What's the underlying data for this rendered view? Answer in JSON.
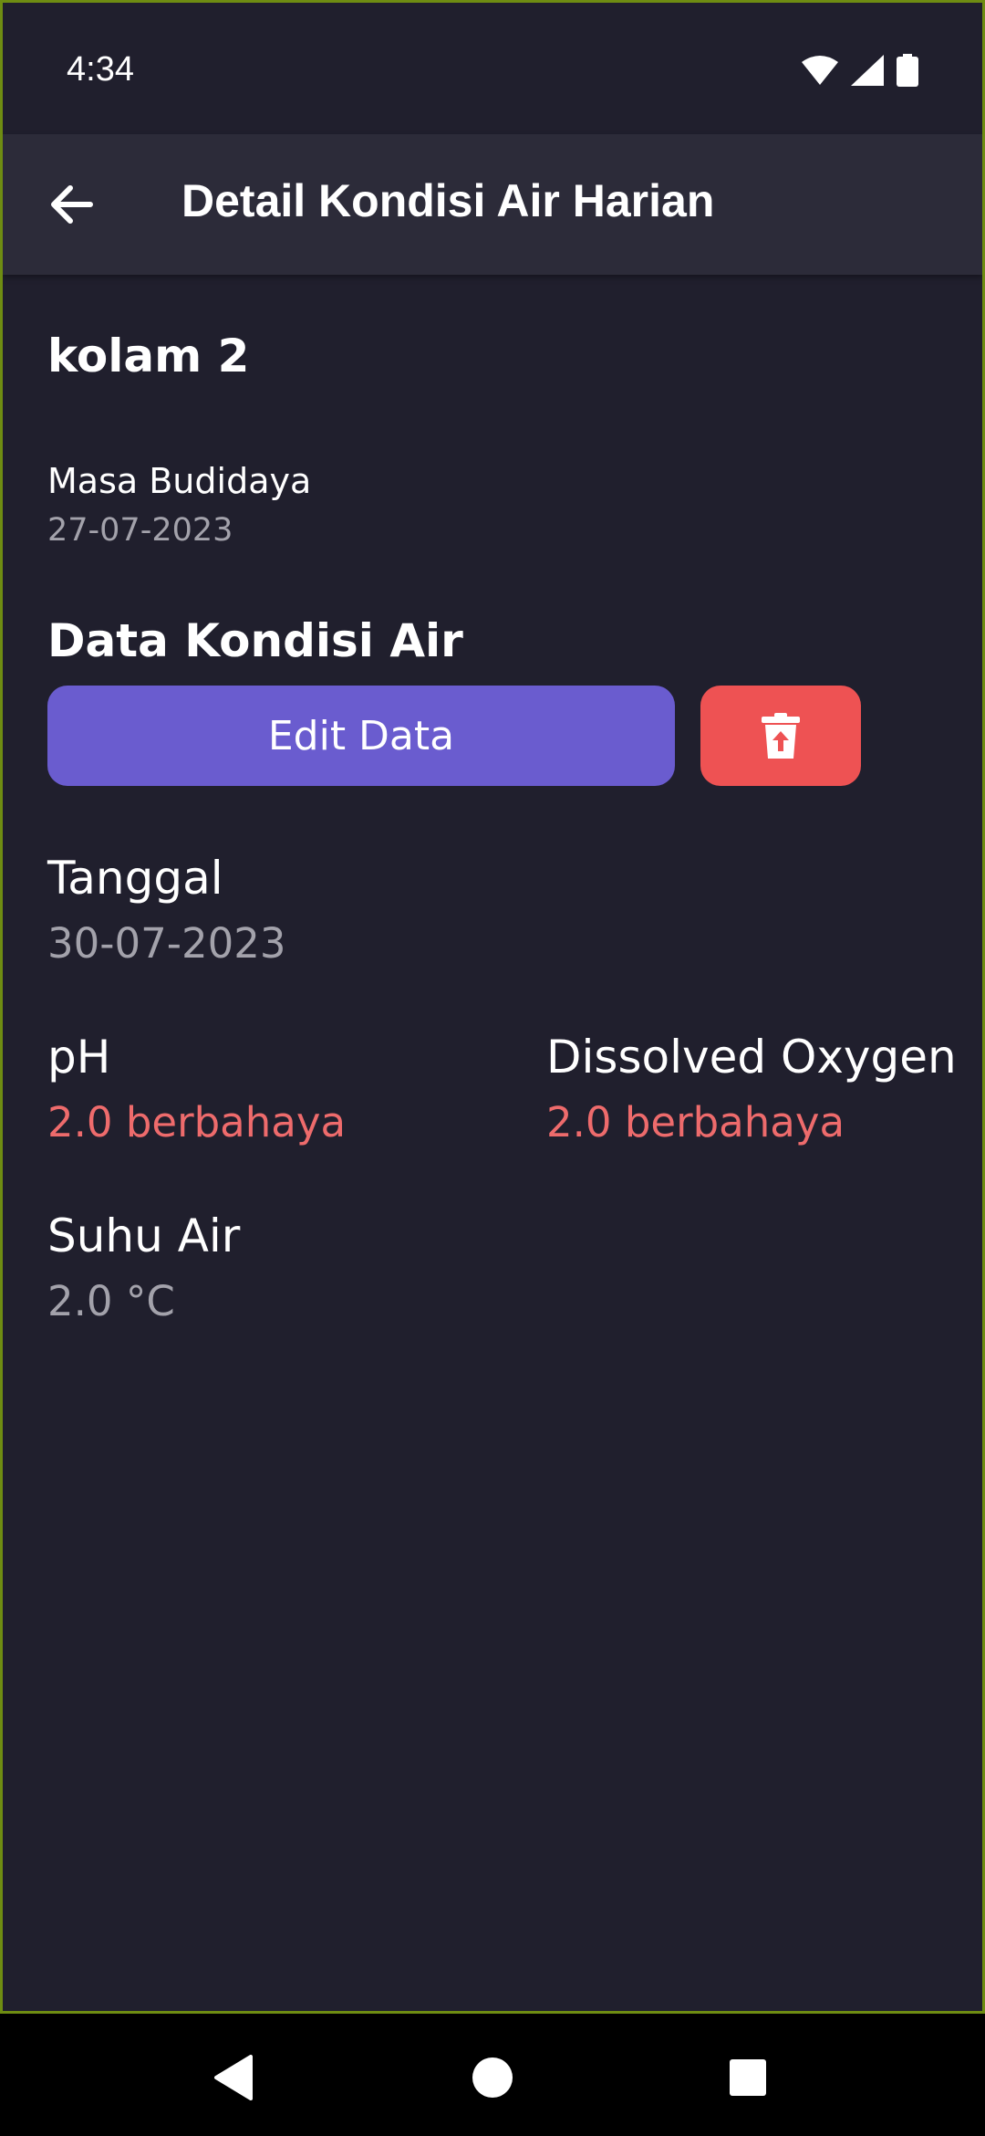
{
  "status_bar": {
    "time": "4:34"
  },
  "app_bar": {
    "title": "Detail Kondisi Air Harian"
  },
  "pond": {
    "name": "kolam 2",
    "masa_label": "Masa Budidaya",
    "masa_value": "27-07-2023"
  },
  "section": {
    "title": "Data Kondisi Air",
    "edit_label": "Edit Data"
  },
  "fields": {
    "tanggal": {
      "label": "Tanggal",
      "value": "30-07-2023"
    },
    "ph": {
      "label": "pH",
      "value": "2.0 berbahaya"
    },
    "do": {
      "label": "Dissolved Oxygen",
      "value": "2.0 berbahaya"
    },
    "suhu": {
      "label": "Suhu Air",
      "value": "2.0 °C"
    }
  },
  "colors": {
    "background": "#201f2d",
    "app_bar": "#2c2b39",
    "primary": "#6a5ccf",
    "danger": "#ee5253",
    "danger_text": "#ee6b6c",
    "muted_text": "#a3a2ab"
  },
  "icons": {
    "back": "arrow-left-icon",
    "delete": "trash-icon",
    "wifi": "wifi-icon",
    "signal": "signal-icon",
    "battery": "battery-icon",
    "nav_back": "triangle-back-icon",
    "nav_home": "circle-home-icon",
    "nav_recents": "square-recents-icon"
  }
}
